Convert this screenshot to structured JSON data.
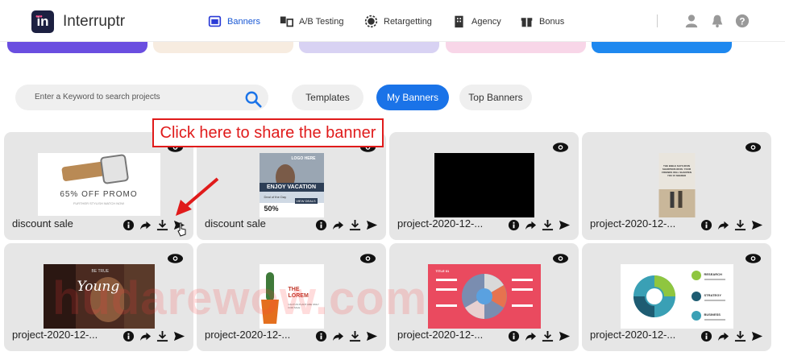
{
  "app": {
    "name": "Interruptr",
    "logo_letters": "in"
  },
  "nav": {
    "items": [
      {
        "label": "Banners",
        "icon": "banner-icon",
        "active": true
      },
      {
        "label": "A/B Testing",
        "icon": "ab-testing-icon",
        "active": false
      },
      {
        "label": "Retargetting",
        "icon": "retargetting-icon",
        "active": false
      },
      {
        "label": "Agency",
        "icon": "agency-icon",
        "active": false
      },
      {
        "label": "Bonus",
        "icon": "gift-icon",
        "active": false
      }
    ],
    "right_icons": [
      "user-icon",
      "bell-icon",
      "help-icon"
    ]
  },
  "colors": {
    "accent": "#1a73e8",
    "nav_active": "#1857d4",
    "annotation": "#e01b1b",
    "card_bg": "#e6e6e6",
    "stripes": [
      "#6a4ee0",
      "#f7ece0",
      "#d8d2f3",
      "#f8d6e8",
      "#1e88ef"
    ]
  },
  "search": {
    "placeholder": "Enter a Keyword to search projects"
  },
  "tabs": [
    {
      "label": "Templates",
      "active": false
    },
    {
      "label": "My Banners",
      "active": true
    },
    {
      "label": "Top Banners",
      "active": false
    }
  ],
  "annotation": {
    "text": "Click here to share the banner"
  },
  "cards": [
    {
      "title": "discount sale",
      "thumb": "watch-promo",
      "thumb_text": "65% OFF PROMO",
      "thumb_sub": "FURTHER STYLISH WATCH NOW"
    },
    {
      "title": "discount sale",
      "thumb": "vacation",
      "thumb_text": "ENJOY VACATION",
      "thumb_sub": "Deal of the Day",
      "thumb_extra": "50%",
      "thumb_logo": "LOGO HERE",
      "thumb_btn": "VIEW DEALS"
    },
    {
      "title": "project-2020-12-...",
      "thumb": "black"
    },
    {
      "title": "project-2020-12-...",
      "thumb": "couple",
      "thumb_text": "THE BIBLE SAYS IRON SHARPENS IRON. YOUR FRIENDS WILL SHARPEN YOU IF NEEDED"
    },
    {
      "title": "project-2020-12-...",
      "thumb": "young",
      "thumb_text": "Young",
      "thumb_sub": "BE TRUE"
    },
    {
      "title": "project-2020-12-...",
      "thumb": "cactus",
      "thumb_text": "THE LOREM",
      "thumb_sub": "CACTUS PLANT ARE ONLY FOR SALE"
    },
    {
      "title": "project-2020-12-...",
      "thumb": "infographic-red",
      "thumb_text": "TITLE 01"
    },
    {
      "title": "project-2020-12-...",
      "thumb": "infographic-steps",
      "thumb_text": "RESEARCH",
      "thumb_sub": "STRATEGY",
      "thumb_extra": "BUSINESS"
    }
  ],
  "watermark": "hudarewow.com"
}
